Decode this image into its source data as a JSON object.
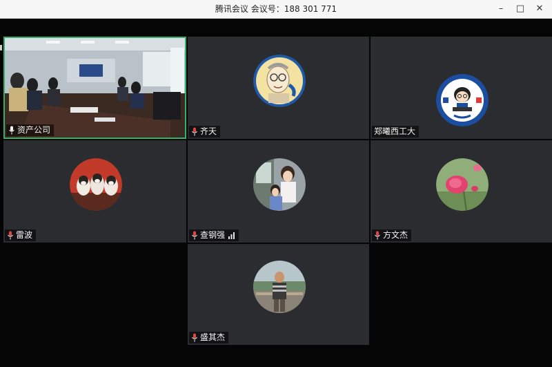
{
  "window": {
    "title": "腾讯会议 会议号：188 301 771",
    "minimize_glyph": "–",
    "maximize_glyph": "□",
    "close_glyph": "✕"
  },
  "accent_color": "#36b06a",
  "participants": [
    {
      "name": "资产公司",
      "mic": "mic-on-icon",
      "active": true,
      "video": true
    },
    {
      "name": "齐天",
      "mic": "mic-muted-icon",
      "avatar": "cartoon-portrait"
    },
    {
      "name": "郑曦西工大",
      "mic": "",
      "avatar": "cartoon-badge-logo"
    },
    {
      "name": "雷波",
      "mic": "mic-muted-icon",
      "avatar": "puppies-photo"
    },
    {
      "name": "查钢强",
      "mic": "mic-muted-icon",
      "avatar": "children-photo",
      "signal": "signal-bars-icon"
    },
    {
      "name": "方文杰",
      "mic": "mic-muted-icon",
      "avatar": "pink-flower-photo"
    },
    {
      "name": "盛其杰",
      "mic": "mic-muted-icon",
      "avatar": "man-outdoor-photo"
    }
  ]
}
